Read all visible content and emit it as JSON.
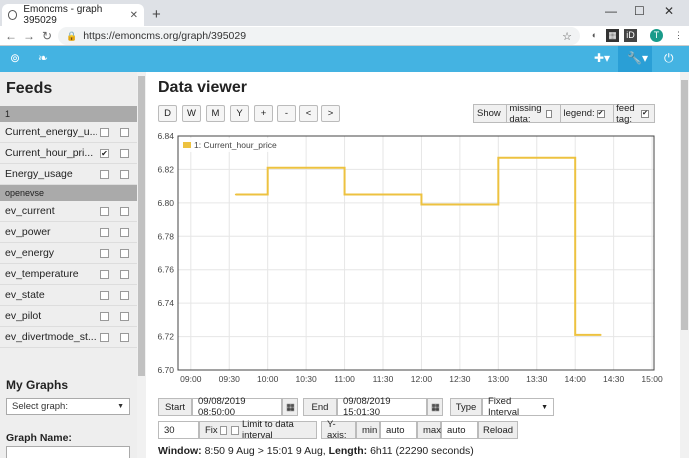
{
  "browser": {
    "tab_title": "Emoncms - graph 395029",
    "url": "https://emoncms.org/graph/395029"
  },
  "sidebar": {
    "title": "Feeds",
    "groups": [
      {
        "label": "1",
        "feeds": [
          {
            "name": "Current_energy_u...",
            "left_checked": false,
            "right_checked": false
          },
          {
            "name": "Current_hour_pri...",
            "left_checked": true,
            "right_checked": false
          },
          {
            "name": "Energy_usage",
            "left_checked": false,
            "right_checked": false
          }
        ]
      },
      {
        "label": "openevse",
        "feeds": [
          {
            "name": "ev_current",
            "left_checked": false,
            "right_checked": false
          },
          {
            "name": "ev_power",
            "left_checked": false,
            "right_checked": false
          },
          {
            "name": "ev_energy",
            "left_checked": false,
            "right_checked": false
          },
          {
            "name": "ev_temperature",
            "left_checked": false,
            "right_checked": false
          },
          {
            "name": "ev_state",
            "left_checked": false,
            "right_checked": false
          },
          {
            "name": "ev_pilot",
            "left_checked": false,
            "right_checked": false
          },
          {
            "name": "ev_divertmode_st...",
            "left_checked": false,
            "right_checked": false
          }
        ]
      }
    ],
    "my_graphs_title": "My Graphs",
    "select_graph": "Select graph:",
    "graph_name_label": "Graph Name:"
  },
  "main": {
    "title": "Data viewer",
    "time_buttons": [
      "D",
      "W",
      "M",
      "Y",
      "+",
      "-",
      "<",
      ">"
    ],
    "options": {
      "show_label": "Show",
      "missing_data_label": "missing data:",
      "missing_data_checked": false,
      "legend_label": "legend:",
      "legend_checked": true,
      "feed_tag_label": "feed tag:",
      "feed_tag_checked": true
    },
    "controls": {
      "start_label": "Start",
      "start_value": "09/08/2019 08:50:00",
      "end_label": "End",
      "end_value": "09/08/2019 15:01:30",
      "type_label": "Type",
      "type_value": "Fixed Interval",
      "interval_value": "30",
      "fix_label": "Fix",
      "limit_label": "Limit to data interval",
      "yaxis_label": "Y-axis:",
      "min_label": "min",
      "min_value": "auto",
      "max_label": "max",
      "max_value": "auto",
      "reload_label": "Reload"
    },
    "footer": {
      "window_label": "Window:",
      "window_value": "8:50 9 Aug > 15:01 9 Aug,",
      "length_label": "Length:",
      "length_value": "6h11 (22290 seconds)"
    }
  },
  "colors": {
    "accent": "#44b3e2",
    "series": "#edc240"
  },
  "chart_data": {
    "type": "line",
    "legend": [
      "1: Current_hour_price"
    ],
    "legend_position": "top-left",
    "grid": true,
    "x_ticks": [
      "09:00",
      "09:30",
      "10:00",
      "10:30",
      "11:00",
      "11:30",
      "12:00",
      "12:30",
      "13:00",
      "13:30",
      "14:00",
      "14:30",
      "15:00"
    ],
    "y_ticks": [
      "6.84",
      "6.82",
      "6.80",
      "6.78",
      "6.76",
      "6.74",
      "6.72",
      "6.70"
    ],
    "xlim": [
      "08:50",
      "15:01:30"
    ],
    "ylim": [
      6.7,
      6.84
    ],
    "series": [
      {
        "name": "1: Current_hour_price",
        "step": true,
        "x": [
          "09:35",
          "10:00",
          "11:00",
          "12:00",
          "13:00",
          "14:00",
          "14:20"
        ],
        "y": [
          6.805,
          6.821,
          6.805,
          6.799,
          6.827,
          6.721,
          6.721
        ]
      }
    ]
  }
}
